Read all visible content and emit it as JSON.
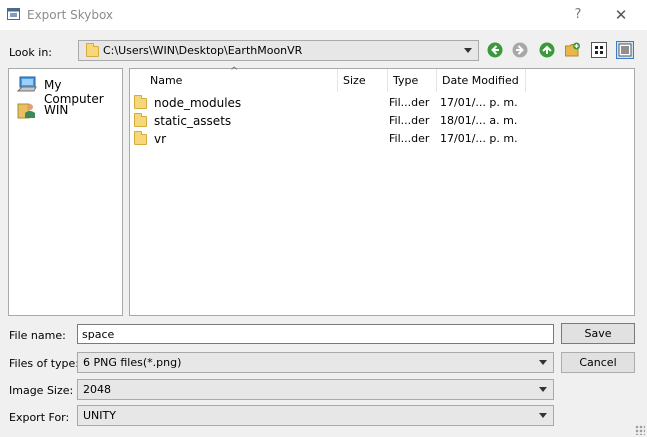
{
  "window": {
    "title": "Export Skybox",
    "help_glyph": "?",
    "close_glyph": "✕"
  },
  "look_in": {
    "label": "Look in:",
    "path": "C:\\Users\\WIN\\Desktop\\EarthMoonVR"
  },
  "toolbar": {
    "icons": [
      "back-icon",
      "forward-icon",
      "parent-folder-icon",
      "new-folder-icon",
      "list-view-icon",
      "detail-view-icon"
    ],
    "back_color": "#3a9a3a"
  },
  "sidebar": {
    "items": [
      {
        "label": "My Computer",
        "icon": "computer-icon"
      },
      {
        "label": "WIN",
        "icon": "user-folder-icon"
      }
    ]
  },
  "file_list": {
    "columns": [
      "Name",
      "Size",
      "Type",
      "Date Modified"
    ],
    "sort_indicator": "^",
    "rows": [
      {
        "name": "node_modules",
        "size": "",
        "type": "Fil...der",
        "date": "17/01/... p. m."
      },
      {
        "name": "static_assets",
        "size": "",
        "type": "Fil...der",
        "date": "18/01/... a. m."
      },
      {
        "name": "vr",
        "size": "",
        "type": "Fil...der",
        "date": "17/01/... p. m."
      }
    ]
  },
  "form": {
    "file_name_label": "File name:",
    "file_name_value": "space",
    "file_type_label": "Files of type:",
    "file_type_value": "6 PNG files(*.png)",
    "image_size_label": "Image Size:",
    "image_size_value": "2048",
    "export_for_label": "Export For:",
    "export_for_value": "UNITY"
  },
  "buttons": {
    "save": "Save",
    "cancel": "Cancel"
  }
}
